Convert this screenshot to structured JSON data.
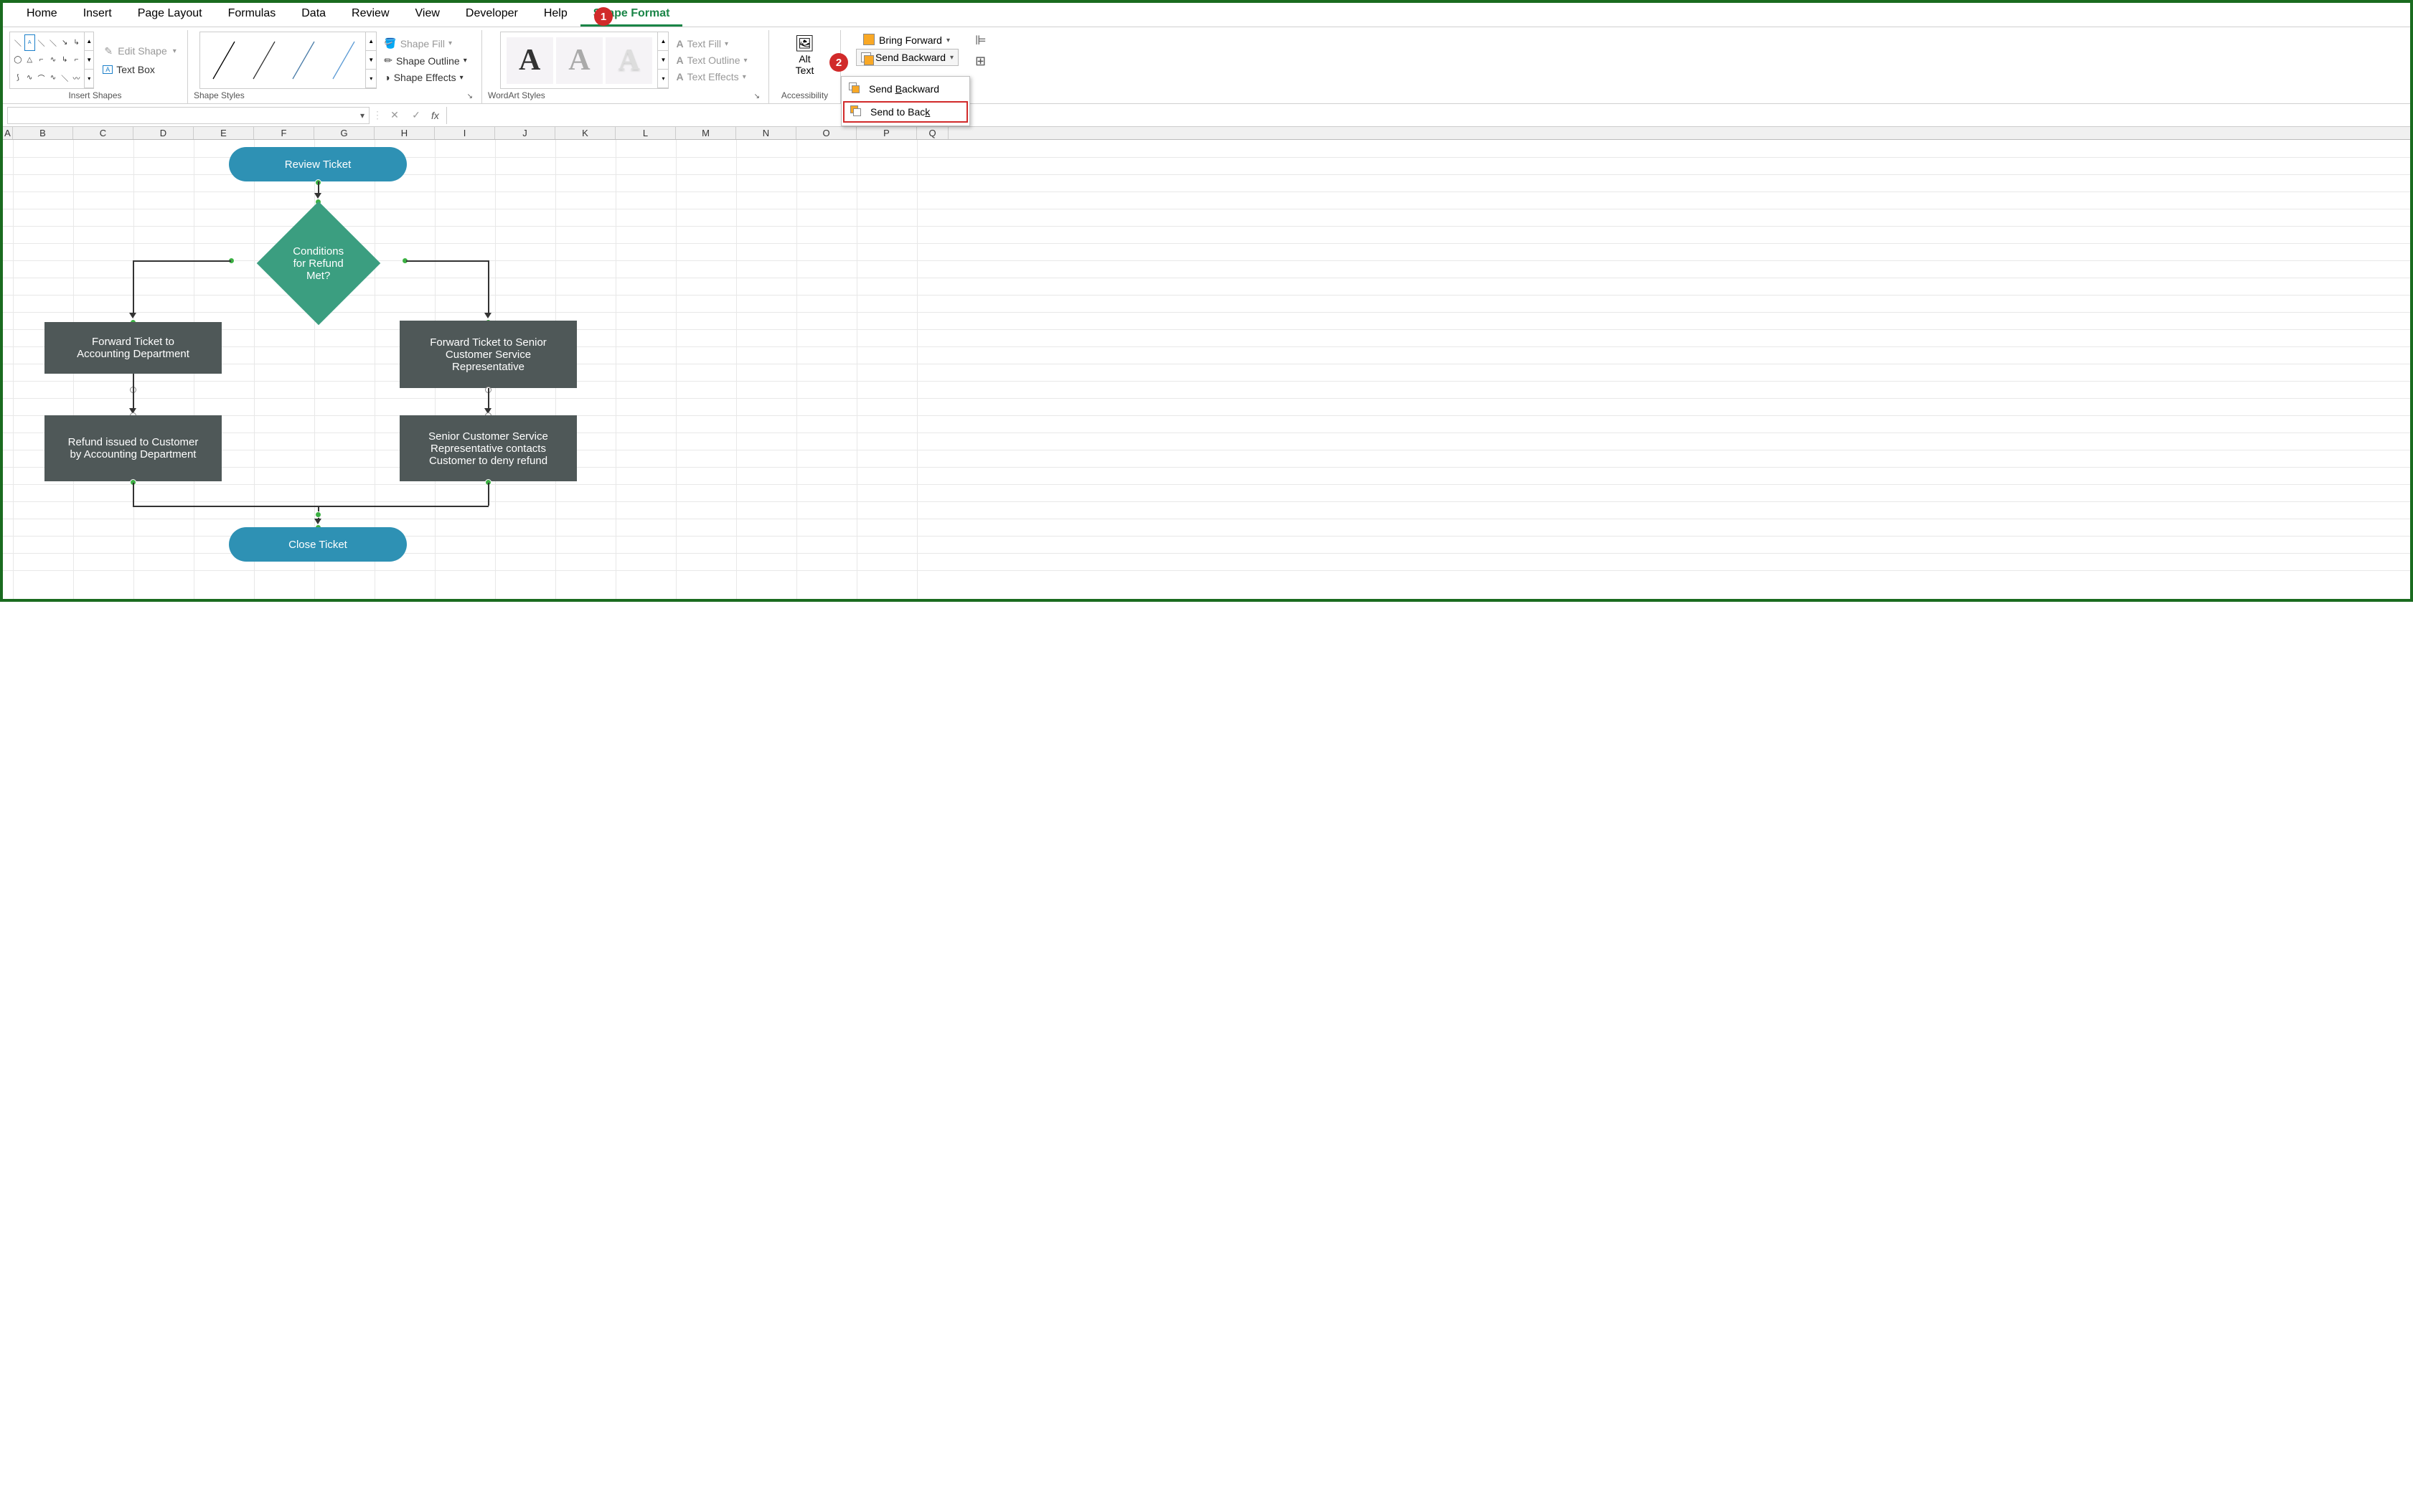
{
  "tabs": {
    "home": "Home",
    "insert": "Insert",
    "page_layout": "Page Layout",
    "formulas": "Formulas",
    "data": "Data",
    "review": "Review",
    "view": "View",
    "developer": "Developer",
    "help": "Help",
    "shape_format": "Shape Format"
  },
  "groups": {
    "insert_shapes": "Insert Shapes",
    "shape_styles": "Shape Styles",
    "wordart_styles": "WordArt Styles",
    "accessibility": "Accessibility"
  },
  "buttons": {
    "edit_shape": "Edit Shape",
    "text_box": "Text Box",
    "shape_fill": "Shape Fill",
    "shape_outline": "Shape Outline",
    "shape_effects": "Shape Effects",
    "text_fill": "Text Fill",
    "text_outline": "Text Outline",
    "text_effects": "Text Effects",
    "alt_text_1": "Alt",
    "alt_text_2": "Text",
    "bring_forward": "Bring Forward",
    "send_backward": "Send Backward",
    "dd_send_backward": "Send Backward",
    "dd_send_to_back": "Send to Back"
  },
  "wa_glyph": "A",
  "formula_bar": {
    "fx": "fx"
  },
  "columns": [
    "A",
    "B",
    "C",
    "D",
    "E",
    "F",
    "G",
    "H",
    "I",
    "J",
    "K",
    "L",
    "M",
    "N",
    "O",
    "P",
    "Q"
  ],
  "callouts": {
    "one": "1",
    "two": "2"
  },
  "flowchart": {
    "review_ticket": "Review Ticket",
    "conditions_line1": "Conditions",
    "conditions_line2": "for Refund",
    "conditions_line3": "Met?",
    "forward_accounting_l1": "Forward Ticket  to",
    "forward_accounting_l2": "Accounting Department",
    "forward_senior_l1": "Forward Ticket to Senior",
    "forward_senior_l2": "Customer Service",
    "forward_senior_l3": "Representative",
    "refund_issued_l1": "Refund issued to Customer",
    "refund_issued_l2": "by Accounting Department",
    "senior_contacts_l1": "Senior Customer Service",
    "senior_contacts_l2": "Representative contacts",
    "senior_contacts_l3": "Customer to deny refund",
    "close_ticket": "Close Ticket"
  }
}
